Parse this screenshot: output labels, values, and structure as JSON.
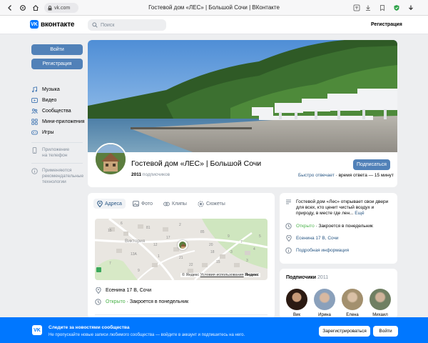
{
  "browser": {
    "url": "vk.com",
    "page_title": "Гостевой дом «ЛЕС» | Большой Сочи | ВКонтакте"
  },
  "header": {
    "logo_text": "вконтакте",
    "logo_mark": "VK",
    "search_placeholder": "Поиск",
    "register_link": "Регистрация"
  },
  "left": {
    "login_button": "Войти",
    "register_button": "Регистрация",
    "nav": [
      {
        "label": "Музыка",
        "icon": "music-icon"
      },
      {
        "label": "Видео",
        "icon": "video-icon"
      },
      {
        "label": "Сообщества",
        "icon": "communities-icon"
      },
      {
        "label": "Мини-приложения",
        "icon": "mini-apps-icon"
      },
      {
        "label": "Игры",
        "icon": "games-icon"
      }
    ],
    "app_line1": "Приложение",
    "app_line2": "на телефон",
    "rec_line1": "Применяются",
    "rec_line2": "рекомендательные",
    "rec_line3": "технологии"
  },
  "group": {
    "name": "Гостевой дом «ЛЕС» | Большой Сочи",
    "subscribers_count": "2011",
    "subscribers_label": "подписчиков",
    "subscribe_button": "Подписаться",
    "respond_label": "Быстро отвечает",
    "respond_time": "· время ответа — 15 минут"
  },
  "tabs": [
    {
      "label": "Адреса",
      "icon": "location-icon",
      "active": true
    },
    {
      "label": "Фото",
      "icon": "photo-icon",
      "active": false
    },
    {
      "label": "Клипы",
      "icon": "clips-icon",
      "active": false
    },
    {
      "label": "Сюжеты",
      "icon": "stories-icon",
      "active": false
    }
  ],
  "map": {
    "place_label": "Виктория",
    "credit_brand": "© Яндекс",
    "credit_terms": "Условия использования",
    "credit_logo": "Яндекс",
    "house_numbers": [
      "15",
      "81",
      "13А",
      "1",
      "17",
      "20",
      "18",
      "85",
      "9",
      "7",
      "4",
      "3",
      "15",
      "22",
      "21",
      "7",
      "9",
      "5",
      "3",
      "2",
      "6",
      "12"
    ]
  },
  "address_card": {
    "address": "Есенина 17 В, Сочи",
    "status_open": "Открыто",
    "status_close": "· Закроется в понедельник"
  },
  "about": {
    "text": "Гостевой дом «Лес» открывает свои двери для всех, кто ценит чистый воздух и природу, в месте где лен...",
    "more": "Ещё",
    "status_open": "Открыто",
    "status_close": "· Закроется в понедельник",
    "address": "Есенина 17 В, Сочи",
    "details": "Подробная информация"
  },
  "subscribers": {
    "title": "Подписчики",
    "count": "2011",
    "people": [
      {
        "name": "Вик",
        "color": "#2b1a12"
      },
      {
        "name": "Ирина",
        "color": "#8aa0bb"
      },
      {
        "name": "Елена",
        "color": "#a3906e"
      },
      {
        "name": "Михаил",
        "color": "#6f7f62"
      }
    ]
  },
  "banner": {
    "logo_mark": "VK",
    "title": "Следите за новостями сообщества",
    "text": "Не пропускайте новые записи любимого сообщества — войдите в аккаунт и подпишитесь на него.",
    "register_button": "Зарегистрироваться",
    "login_button": "Войти"
  },
  "colors": {
    "brand": "#0077ff",
    "button": "#5181b8",
    "link": "#2a5885",
    "open_status": "#4bb34b",
    "page_bg": "#edeef0"
  }
}
